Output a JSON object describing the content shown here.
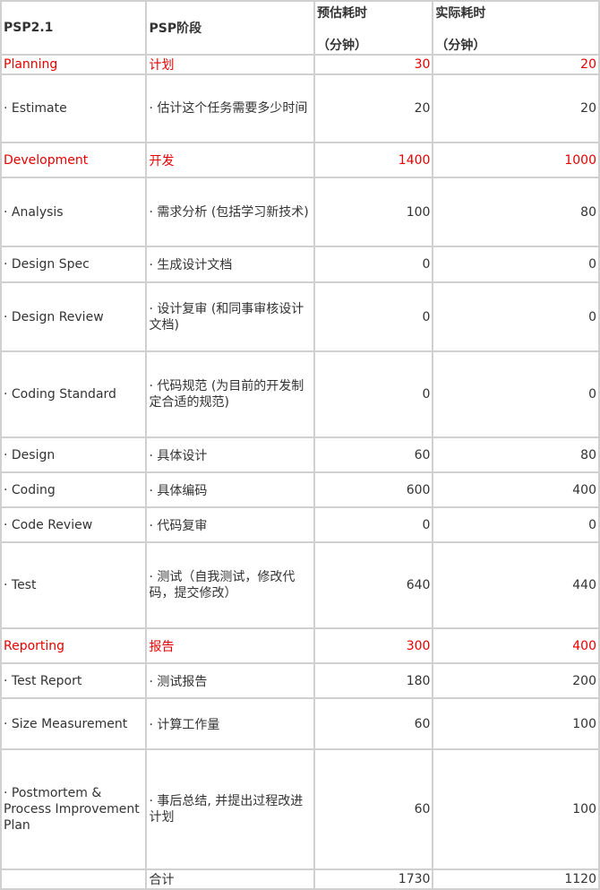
{
  "header": {
    "col1": "PSP2.1",
    "col2": "PSP阶段",
    "col3_line1": "预估耗时",
    "col3_line2": "（分钟）",
    "col4_line1": "实际耗时",
    "col4_line2": "（分钟）"
  },
  "rows": [
    {
      "name": "Planning",
      "stage": "计划",
      "est": "30",
      "act": "20"
    },
    {
      "name": "· Estimate",
      "stage": "· 估计这个任务需要多少时间",
      "est": "20",
      "act": "20"
    },
    {
      "name": "Development",
      "stage": "开发",
      "est": "1400",
      "act": "1000"
    },
    {
      "name": "· Analysis",
      "stage": "· 需求分析 (包括学习新技术)",
      "est": "100",
      "act": "80"
    },
    {
      "name": "· Design Spec",
      "stage": "· 生成设计文档",
      "est": "0",
      "act": "0"
    },
    {
      "name": "· Design Review",
      "stage": "· 设计复审 (和同事审核设计文档)",
      "est": "0",
      "act": "0"
    },
    {
      "name": "· Coding Standard",
      "stage": "· 代码规范 (为目前的开发制定合适的规范)",
      "est": "0",
      "act": "0"
    },
    {
      "name": "· Design",
      "stage": "· 具体设计",
      "est": "60",
      "act": "80"
    },
    {
      "name": "· Coding",
      "stage": "· 具体编码",
      "est": "600",
      "act": "400"
    },
    {
      "name": "· Code Review",
      "stage": "· 代码复审",
      "est": "0",
      "act": "0"
    },
    {
      "name": "· Test",
      "stage": "· 测试（自我测试，修改代码，提交修改）",
      "est": "640",
      "act": "440"
    },
    {
      "name": "Reporting",
      "stage": "报告",
      "est": "300",
      "act": "400"
    },
    {
      "name": "· Test Report",
      "stage": "· 测试报告",
      "est": "180",
      "act": "200"
    },
    {
      "name": "· Size Measurement",
      "stage": "· 计算工作量",
      "est": "60",
      "act": "100"
    },
    {
      "name": "· Postmortem & Process Improvement Plan",
      "stage": "· 事后总结, 并提出过程改进计划",
      "est": "60",
      "act": "100"
    },
    {
      "name": "",
      "stage": "合计",
      "est": "1730",
      "act": "1120"
    }
  ],
  "colors": {
    "section_text": "#e60000",
    "border": "#d0d0d0",
    "text": "#333333"
  }
}
